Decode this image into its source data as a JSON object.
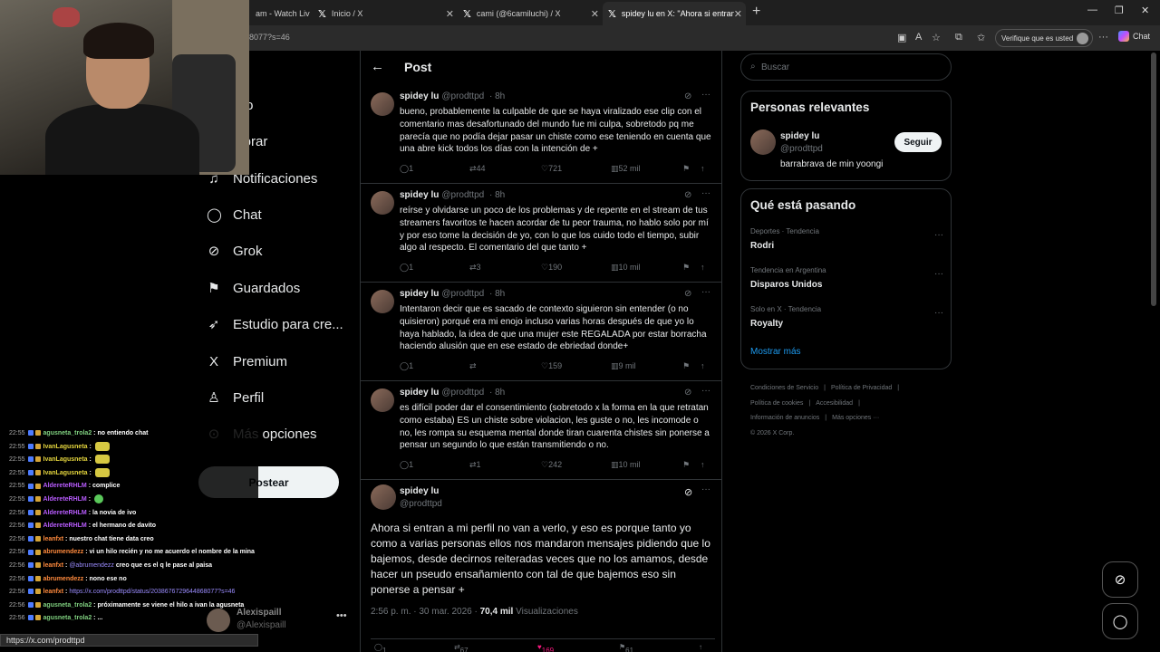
{
  "browser": {
    "tabs": [
      {
        "title": "am - Watch Liv",
        "close": "✕"
      },
      {
        "title": "Inicio / X",
        "close": "✕"
      },
      {
        "title": "cami (@6camiluchi) / X",
        "close": "✕"
      },
      {
        "title": "spidey lu en X: \"Ahora si entran a",
        "close": "✕"
      }
    ],
    "new_tab": "+",
    "url": "8077?s=46",
    "verify_label": "Verifique que es usted",
    "chat_label": "Chat",
    "status_url": "https://x.com/prodttpd"
  },
  "nav": {
    "items": [
      {
        "label": "icio",
        "icon": "⌂"
      },
      {
        "label": "plorar",
        "icon": "⌕"
      },
      {
        "label": "Notificaciones",
        "icon": "♫"
      },
      {
        "label": "Chat",
        "icon": "◯"
      },
      {
        "label": "Grok",
        "icon": "⊘"
      },
      {
        "label": "Guardados",
        "icon": "⚑"
      },
      {
        "label": "Estudio para cre...",
        "icon": "➶"
      },
      {
        "label": "Premium",
        "icon": "X"
      },
      {
        "label": "Perfil",
        "icon": "♙"
      },
      {
        "label": "Más opciones",
        "icon": "⊙"
      }
    ],
    "post_button": "Postear",
    "profile": {
      "name": "Alexispaill",
      "handle": "@Alexispaill",
      "more": "•••"
    }
  },
  "twitch_chat": [
    {
      "time": "22:55",
      "user": "agusneta_trola2",
      "user_color": "#7fd07f",
      "msg": "no entiendo chat"
    },
    {
      "time": "22:55",
      "user": "IvanLagusneta",
      "user_color": "#e3d43d",
      "msg": "",
      "emote": true
    },
    {
      "time": "22:55",
      "user": "IvanLagusneta",
      "user_color": "#e3d43d",
      "msg": "",
      "emote": true
    },
    {
      "time": "22:55",
      "user": "IvanLagusneta",
      "user_color": "#e3d43d",
      "msg": "",
      "emote": true
    },
    {
      "time": "22:55",
      "user": "AldereteRHLM",
      "user_color": "#b95cff",
      "msg": "complice"
    },
    {
      "time": "22:55",
      "user": "AldereteRHLM",
      "user_color": "#b95cff",
      "msg": "",
      "emote_g": true
    },
    {
      "time": "22:56",
      "user": "AldereteRHLM",
      "user_color": "#b95cff",
      "msg": "la novia de ivo"
    },
    {
      "time": "22:56",
      "user": "AldereteRHLM",
      "user_color": "#b95cff",
      "msg": "el hermano de davito"
    },
    {
      "time": "22:56",
      "user": "leanfxt",
      "user_color": "#ff8a3d",
      "msg": "nuestro chat tiene data creo"
    },
    {
      "time": "22:56",
      "user": "abrumendezz",
      "user_color": "#ff8a3d",
      "msg": "vi un hilo recién y no me acuerdo el nombre de la mina"
    },
    {
      "time": "22:56",
      "user": "leanfxt",
      "user_color": "#ff8a3d",
      "msg": "creo que es el q le pase al paisa",
      "mention": "@abrumendezz"
    },
    {
      "time": "22:56",
      "user": "abrumendezz",
      "user_color": "#ff8a3d",
      "msg": "nono ese no"
    },
    {
      "time": "22:56",
      "user": "leanfxt",
      "user_color": "#ff8a3d",
      "msg": "",
      "link": "https://x.com/prodttpd/status/2038676729644868077?s=46"
    },
    {
      "time": "22:56",
      "user": "agusneta_trola2",
      "user_color": "#7fd07f",
      "msg": "próximamente se viene el hilo a ivan la agusneta"
    },
    {
      "time": "22:56",
      "user": "agusneta_trola2",
      "user_color": "#7fd07f",
      "msg": "..."
    }
  ],
  "main": {
    "back_icon": "←",
    "title": "Post",
    "replies": [
      {
        "name": "spidey lu",
        "handle": "@prodttpd",
        "time": "· 8h",
        "text": "bueno, probablemente la culpable de que se haya viralizado ese clip con el comentario mas desafortunado del mundo fue mi culpa, sobretodo pq me parecía que no podía dejar pasar un chiste como ese teniendo en cuenta que una abre kick todos los días con la intención de +",
        "replies": "1",
        "reposts": "44",
        "likes": "721",
        "views": "52 mil"
      },
      {
        "name": "spidey lu",
        "handle": "@prodttpd",
        "time": "· 8h",
        "text": "reírse y olvidarse un poco de los problemas y de repente en el stream de tus streamers favoritos te hacen acordar de tu peor trauma, no hablo solo por mí y por eso tome la decisión de yo, con lo que los cuido todo el tiempo, subir algo al respecto. El comentario del que tanto +",
        "replies": "1",
        "reposts": "3",
        "likes": "190",
        "views": "10 mil"
      },
      {
        "name": "spidey lu",
        "handle": "@prodttpd",
        "time": "· 8h",
        "text": "Intentaron decir que es sacado de contexto siguieron sin entender (o no quisieron) porqué era mi enojo incluso varias horas después de que yo lo haya hablado, la idea de que una mujer este REGALADA por estar borracha haciendo alusión que en ese estado de ebriedad donde+",
        "replies": "1",
        "reposts": "",
        "likes": "159",
        "views": "9 mil"
      },
      {
        "name": "spidey lu",
        "handle": "@prodttpd",
        "time": "· 8h",
        "text": "es difícil poder dar el consentimiento (sobretodo x la forma en la que retratan como estaba) ES un chiste sobre violacion, les guste o no, les incomode o no, les rompa su esquema mental donde tiran cuarenta chistes sin ponerse a pensar un segundo lo que están transmitiendo o no.",
        "replies": "1",
        "reposts": "1",
        "likes": "242",
        "views": "10 mil"
      }
    ],
    "post": {
      "name": "spidey lu",
      "handle": "@prodttpd",
      "text": "Ahora si entran a mi perfil no van a verlo, y eso es porque tanto yo como a varias personas ellos nos mandaron mensajes pidiendo que lo bajemos, desde decirnos reiteradas veces que no los amamos, desde hacer un pseudo ensañamiento con tal de que bajemos eso sin ponerse a pensar +",
      "timestamp": "2:56 p. m. · 30 mar. 2026 ·",
      "views_count": "70,4 mil",
      "views_label": "Visualizaciones",
      "replies": "1",
      "reposts": "67",
      "likes": "169",
      "bookmarks": "61"
    }
  },
  "right": {
    "search_placeholder": "Buscar",
    "relevant": {
      "title": "Personas relevantes",
      "name": "spidey lu",
      "handle": "@prodttpd",
      "bio": "barrabrava de min yoongi",
      "follow": "Seguir"
    },
    "trends": {
      "title": "Qué está pasando",
      "items": [
        {
          "context": "Deportes · Tendencia",
          "topic": "Rodri"
        },
        {
          "context": "Tendencia en Argentina",
          "topic": "Disparos Unidos"
        },
        {
          "context": "Solo en X · Tendencia",
          "topic": "Royalty"
        }
      ],
      "show_more": "Mostrar más"
    },
    "footer": [
      "Condiciones de Servicio",
      "|",
      "Política de Privacidad",
      "|",
      "Política de cookies",
      "|",
      "Accesibilidad",
      "|",
      "Información de anuncios",
      "|",
      "Más opciones ···",
      "© 2026 X Corp."
    ]
  },
  "colors": {
    "accent": "#1d9bf0",
    "like_active": "#f91880",
    "bg": "#000000"
  }
}
